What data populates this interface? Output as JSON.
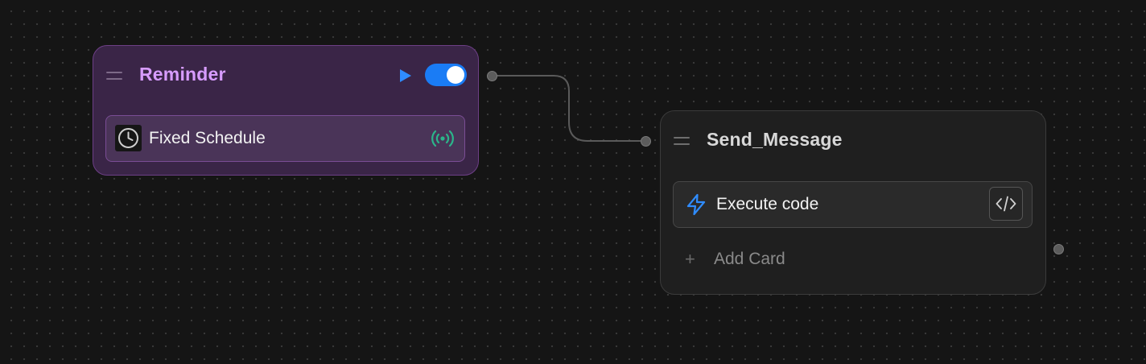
{
  "nodes": {
    "reminder": {
      "title": "Reminder",
      "enabled": true,
      "card": {
        "label": "Fixed Schedule",
        "icon": "clock-icon",
        "trigger_icon": "broadcast-signal-icon"
      }
    },
    "send_message": {
      "title": "Send_Message",
      "card": {
        "label": "Execute code",
        "icon": "lightning-bolt-icon",
        "action_icon": "code-icon"
      },
      "add_card_label": "Add Card"
    }
  },
  "colors": {
    "canvas_bg": "#151515",
    "reminder_title": "#d79cff",
    "reminder_bg": "#3a2547",
    "toggle_on": "#1a7cf5",
    "run_icon": "#2f8cff",
    "signal_icon": "#2bb58a",
    "bolt_icon": "#2f8cff"
  }
}
